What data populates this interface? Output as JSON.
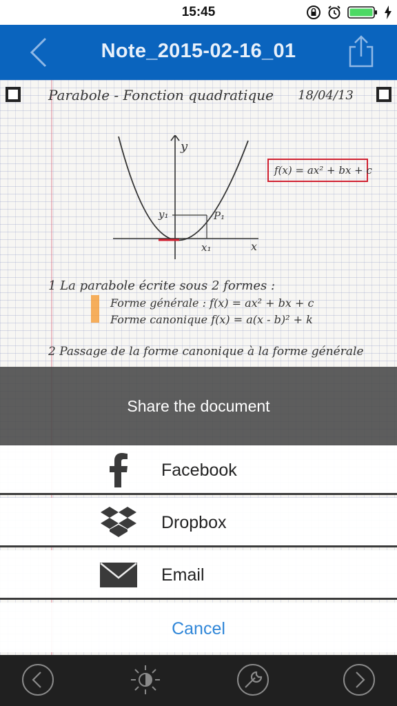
{
  "status_bar": {
    "time": "15:45"
  },
  "nav": {
    "title": "Note_2015-02-16_01"
  },
  "document": {
    "heading": "Parabole - Fonction quadratique",
    "date": "18/04/13",
    "formula_box": "f(x) = ax² + bx + c",
    "graph_labels": {
      "y_axis": "y",
      "x_axis": "x",
      "y1": "y₁",
      "x1": "x₁",
      "p1": "P₁"
    },
    "lines": [
      "1 La parabole écrite sous 2 formes :",
      "Forme générale :    f(x) = ax² + bx + c",
      "Forme canonique    f(x) = a(x - b)² + k",
      "2 Passage de la forme canonique à la forme générale"
    ]
  },
  "share_sheet": {
    "title": "Share the document",
    "options": [
      {
        "label": "Facebook",
        "icon": "facebook-icon"
      },
      {
        "label": "Dropbox",
        "icon": "dropbox-icon"
      },
      {
        "label": "Email",
        "icon": "email-icon"
      }
    ],
    "cancel_label": "Cancel"
  },
  "toolbar": {
    "buttons": [
      "previous-icon",
      "brightness-icon",
      "tools-icon",
      "next-icon"
    ]
  },
  "colors": {
    "nav_bar": "#0a64be",
    "battery": "#4cd964",
    "cancel_text": "#2f86d8",
    "toolbar": "#202020"
  }
}
